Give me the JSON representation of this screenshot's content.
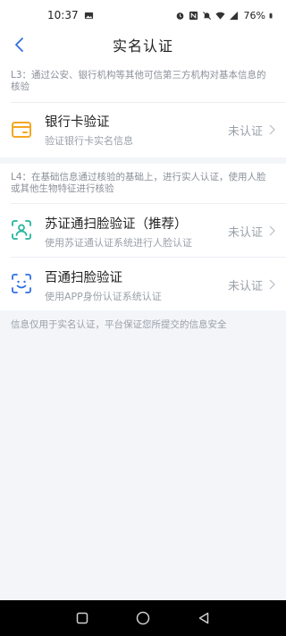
{
  "status_bar": {
    "time": "10:37",
    "battery": "76%",
    "icons": [
      "image-icon",
      "alarm-icon",
      "nfc-icon",
      "mute-icon",
      "wifi-icon",
      "signal-icon",
      "battery-icon"
    ]
  },
  "header": {
    "title": "实名认证",
    "back_icon": "chevron-left-icon",
    "accent_color": "#2f6fe4"
  },
  "l3": {
    "description": "L3：通过公安、银行机构等其他可信第三方机构对基本信息的核验",
    "items": [
      {
        "icon": "bank-card-icon",
        "icon_color": "#f5a623",
        "title": "银行卡验证",
        "subtitle": "验证银行卡实名信息",
        "status": "未认证"
      }
    ]
  },
  "l4": {
    "description": "L4：在基础信息通过核验的基础上，进行实人认证，使用人脸或其他生物特征进行核验",
    "items": [
      {
        "icon": "face-scan-user-icon",
        "icon_color": "#22b59a",
        "title": "苏证通扫脸验证（推荐）",
        "subtitle": "使用苏证通认证系统进行人脸认证",
        "status": "未认证"
      },
      {
        "icon": "face-scan-smile-icon",
        "icon_color": "#2f6fe4",
        "title": "百通扫脸验证",
        "subtitle": "使用APP身份认证系统认证",
        "status": "未认证"
      }
    ]
  },
  "footer_note": "信息仅用于实名认证，平台保证您所提交的信息安全",
  "system_nav": [
    "recents-square-icon",
    "home-circle-icon",
    "back-triangle-icon"
  ]
}
